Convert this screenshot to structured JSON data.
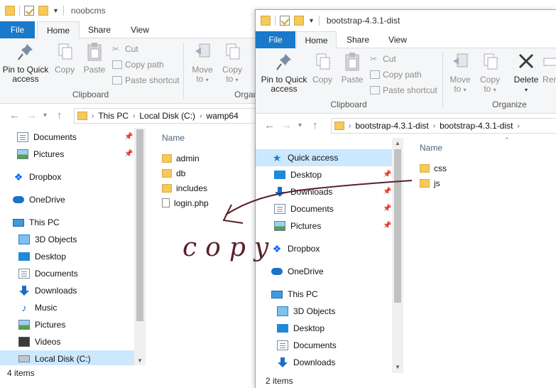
{
  "left_window": {
    "title": "noobcms",
    "tabs": [
      "File",
      "Home",
      "Share",
      "View"
    ],
    "ribbon": {
      "pin_label_1": "Pin to Quick",
      "pin_label_2": "access",
      "copy": "Copy",
      "paste": "Paste",
      "cut": "Cut",
      "copy_path": "Copy path",
      "paste_shortcut": "Paste shortcut",
      "move_to_1": "Move",
      "move_to_2": "to",
      "copy_to_1": "Copy",
      "copy_to_2": "to",
      "clipboard": "Clipboard",
      "organize": "Organiz"
    },
    "address": {
      "crumbs": [
        "This PC",
        "Local Disk (C:)",
        "wamp64"
      ]
    },
    "nav": [
      {
        "label": "Documents",
        "icon": "documents-icon",
        "pinned": true
      },
      {
        "label": "Pictures",
        "icon": "pictures-icon",
        "pinned": true
      },
      {
        "label": "Dropbox",
        "icon": "dropbox-icon"
      },
      {
        "label": "OneDrive",
        "icon": "onedrive-icon"
      },
      {
        "label": "This PC",
        "icon": "this-pc-icon"
      },
      {
        "label": "3D Objects",
        "icon": "3d-objects-icon"
      },
      {
        "label": "Desktop",
        "icon": "desktop-icon"
      },
      {
        "label": "Documents",
        "icon": "documents-icon"
      },
      {
        "label": "Downloads",
        "icon": "downloads-icon"
      },
      {
        "label": "Music",
        "icon": "music-icon"
      },
      {
        "label": "Pictures",
        "icon": "pictures-icon"
      },
      {
        "label": "Videos",
        "icon": "videos-icon"
      },
      {
        "label": "Local Disk (C:)",
        "icon": "local-disk-icon",
        "selected": true
      }
    ],
    "column_name": "Name",
    "files": [
      {
        "name": "admin",
        "type": "folder"
      },
      {
        "name": "db",
        "type": "folder"
      },
      {
        "name": "includes",
        "type": "folder"
      },
      {
        "name": "login.php",
        "type": "file"
      }
    ],
    "status": "4 items"
  },
  "right_window": {
    "title": "bootstrap-4.3.1-dist",
    "tabs": [
      "File",
      "Home",
      "Share",
      "View"
    ],
    "ribbon": {
      "pin_label_1": "Pin to Quick",
      "pin_label_2": "access",
      "copy": "Copy",
      "paste": "Paste",
      "cut": "Cut",
      "copy_path": "Copy path",
      "paste_shortcut": "Paste shortcut",
      "move_to_1": "Move",
      "move_to_2": "to",
      "copy_to_1": "Copy",
      "copy_to_2": "to",
      "delete": "Delete",
      "rename": "Ren",
      "clipboard": "Clipboard",
      "organize": "Organize"
    },
    "address": {
      "crumbs": [
        "bootstrap-4.3.1-dist",
        "bootstrap-4.3.1-dist"
      ]
    },
    "nav": [
      {
        "label": "Quick access",
        "icon": "quick-access-icon",
        "selected": true
      },
      {
        "label": "Desktop",
        "icon": "desktop-icon",
        "pinned": true
      },
      {
        "label": "Downloads",
        "icon": "downloads-icon",
        "pinned": true
      },
      {
        "label": "Documents",
        "icon": "documents-icon",
        "pinned": true
      },
      {
        "label": "Pictures",
        "icon": "pictures-icon",
        "pinned": true
      },
      {
        "label": "Dropbox",
        "icon": "dropbox-icon"
      },
      {
        "label": "OneDrive",
        "icon": "onedrive-icon"
      },
      {
        "label": "This PC",
        "icon": "this-pc-icon"
      },
      {
        "label": "3D Objects",
        "icon": "3d-objects-icon"
      },
      {
        "label": "Desktop",
        "icon": "desktop-icon"
      },
      {
        "label": "Documents",
        "icon": "documents-icon"
      },
      {
        "label": "Downloads",
        "icon": "downloads-icon"
      }
    ],
    "column_name": "Name",
    "files": [
      {
        "name": "css",
        "type": "folder"
      },
      {
        "name": "js",
        "type": "folder"
      }
    ],
    "status": "2 items"
  },
  "annotation": {
    "text": "copy",
    "color": "#5a1f2a"
  },
  "colors": {
    "file_tab": "#1979ca",
    "selection": "#cce8ff"
  }
}
